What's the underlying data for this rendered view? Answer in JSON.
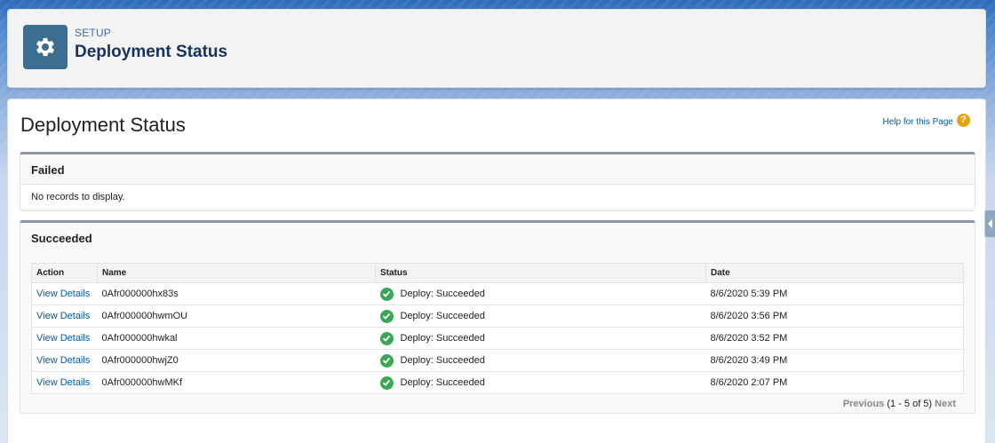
{
  "header": {
    "setup_label": "SETUP",
    "title": "Deployment Status",
    "icon": "gear-icon",
    "icon_bg": "#3c6e90"
  },
  "main": {
    "title": "Deployment Status",
    "help_link": "Help for this Page",
    "help_icon": "?"
  },
  "failed": {
    "title": "Failed",
    "empty_text": "No records to display."
  },
  "succeeded": {
    "title": "Succeeded",
    "columns": [
      "Action",
      "Name",
      "Status",
      "Date"
    ],
    "rows": [
      {
        "action": "View Details",
        "name": "0Afr000000hx83s",
        "status": "Deploy: Succeeded",
        "date": "8/6/2020 5:39 PM"
      },
      {
        "action": "View Details",
        "name": "0Afr000000hwmOU",
        "status": "Deploy: Succeeded",
        "date": "8/6/2020 3:56 PM"
      },
      {
        "action": "View Details",
        "name": "0Afr000000hwkal",
        "status": "Deploy: Succeeded",
        "date": "8/6/2020 3:52 PM"
      },
      {
        "action": "View Details",
        "name": "0Afr000000hwjZ0",
        "status": "Deploy: Succeeded",
        "date": "8/6/2020 3:49 PM"
      },
      {
        "action": "View Details",
        "name": "0Afr000000hwMKf",
        "status": "Deploy: Succeeded",
        "date": "8/6/2020 2:07 PM"
      }
    ],
    "status_icon": "check-circle-icon",
    "status_color": "#3ba755",
    "pagination": {
      "previous": "Previous",
      "count": "(1 - 5 of 5)",
      "next": "Next"
    }
  }
}
